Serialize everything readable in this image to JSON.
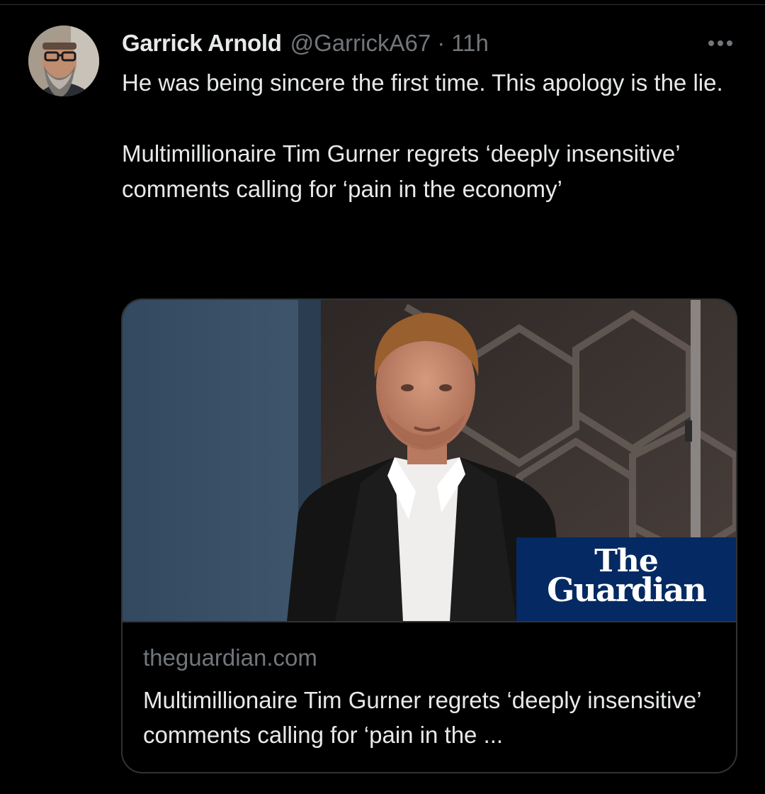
{
  "tweet": {
    "author": {
      "display_name": "Garrick Arnold",
      "handle": "@GarrickA67"
    },
    "separator": "·",
    "timestamp": "11h",
    "text_paragraph_1": "He was being sincere the first time. This apology is the lie.",
    "text_paragraph_2": "Multimillionaire Tim Gurner regrets ‘deeply insensitive’ comments calling for ‘pain in the economy’"
  },
  "link_card": {
    "domain": "theguardian.com",
    "title": "Multimillionaire Tim Gurner regrets ‘deeply insensitive’ comments calling for ‘pain in the ...",
    "logo_line_1": "The",
    "logo_line_2": "Guardian"
  },
  "icons": {
    "more": "more-horizontal-icon"
  },
  "colors": {
    "background": "#000000",
    "text_primary": "#e7e9ea",
    "text_secondary": "#71767b",
    "border": "#2f3336",
    "guardian_blue": "#052962"
  }
}
